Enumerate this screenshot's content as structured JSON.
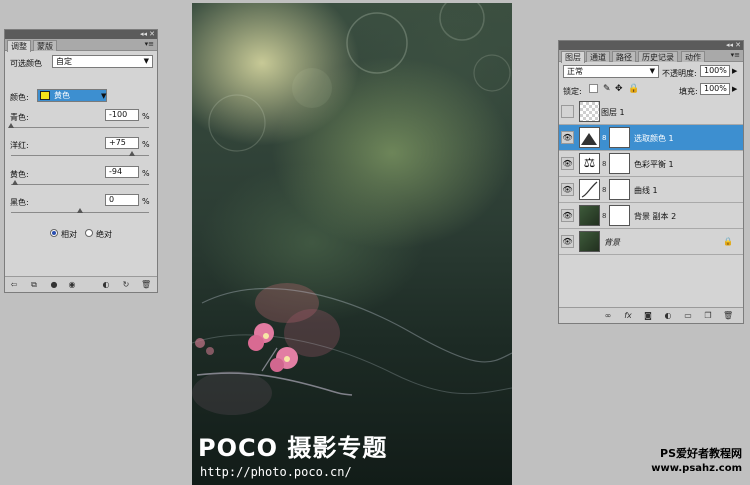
{
  "left_panel": {
    "tabs": [
      "调整",
      "蒙版"
    ],
    "preset_label": "可选颜色",
    "preset_value": "自定",
    "color_label": "颜色:",
    "color_value": "黄色",
    "color_swatch": "#f4e31a",
    "sliders": [
      {
        "label": "青色:",
        "value": "-100",
        "unit": "%",
        "level": 0.0
      },
      {
        "label": "洋红:",
        "value": "+75",
        "unit": "%",
        "level": 0.875
      },
      {
        "label": "黄色:",
        "value": "-94",
        "unit": "%",
        "level": 0.03
      },
      {
        "label": "黑色:",
        "value": "0",
        "unit": "%",
        "level": 0.5
      }
    ],
    "method": {
      "relative": "相对",
      "absolute": "绝对",
      "selected": "relative"
    },
    "bottom_icons": [
      "back-icon",
      "layer-clip-icon",
      "mask-icon",
      "eye-icon",
      "view-previous-icon",
      "reset-icon",
      "trash-icon"
    ]
  },
  "center_image": {
    "watermark_main": "POCO 摄影专题",
    "watermark_url": "http://photo.poco.cn/"
  },
  "layers_panel": {
    "tabs": [
      "图层",
      "通道",
      "路径",
      "历史记录",
      "动作"
    ],
    "blend_mode": "正常",
    "opacity_label": "不透明度:",
    "opacity_value": "100%",
    "lock_label": "锁定:",
    "fill_label": "填充:",
    "fill_value": "100%",
    "layers": [
      {
        "name": "图层 1",
        "visible": false,
        "selected": false
      },
      {
        "name": "选取颜色 1",
        "visible": true,
        "selected": true
      },
      {
        "name": "色彩平衡 1",
        "visible": true,
        "selected": false
      },
      {
        "name": "曲线 1",
        "visible": true,
        "selected": false
      },
      {
        "name": "背景 副本 2",
        "visible": true,
        "selected": false
      },
      {
        "name": "背景",
        "visible": true,
        "selected": false,
        "locked": true
      }
    ],
    "bottom_icons": [
      "link-icon",
      "fx-icon",
      "mask-icon",
      "adjustment-icon",
      "folder-icon",
      "new-layer-icon",
      "trash-icon"
    ]
  },
  "site_watermark": {
    "line1": "PS爱好者教程网",
    "line2": "www.psahz.com"
  },
  "colors": {
    "selection": "#3d8fd0",
    "panel_bg": "#d4d4d4",
    "workspace": "#c0c0c0"
  }
}
